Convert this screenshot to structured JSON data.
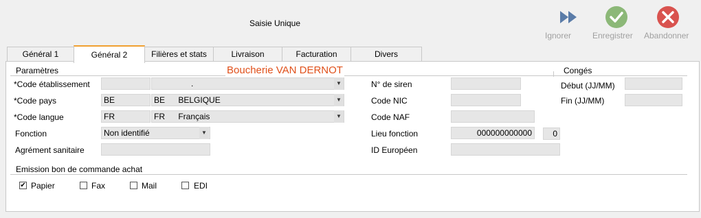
{
  "window": {
    "title": "Saisie Unique"
  },
  "toolbar": {
    "ignore_label": "Ignorer",
    "save_label": "Enregistrer",
    "abandon_label": "Abandonner"
  },
  "tabs": [
    {
      "label": "Général 1"
    },
    {
      "label": "Général 2",
      "active": true
    },
    {
      "label": "Filières et stats"
    },
    {
      "label": "Livraison"
    },
    {
      "label": "Facturation"
    },
    {
      "label": "Divers"
    }
  ],
  "form": {
    "section_params": "Paramètres",
    "company_name": "Boucherie VAN DERNOT",
    "section_conges": "Congés",
    "code_etab_label": "*Code établissement",
    "code_etab_value": "",
    "code_etab_desc": ".",
    "code_pays_label": "*Code pays",
    "code_pays_value": "BE",
    "code_pays_code": "BE",
    "code_pays_name": "BELGIQUE",
    "code_langue_label": "*Code langue",
    "code_langue_value": "FR",
    "code_langue_code": "FR",
    "code_langue_name": "Français",
    "fonction_label": "Fonction",
    "fonction_value": "Non identifié",
    "agrement_label": "Agrément sanitaire",
    "agrement_value": "",
    "siren_label": "N° de siren",
    "siren_value": "",
    "nic_label": "Code NIC",
    "nic_value": "",
    "naf_label": "Code NAF",
    "naf_value": "",
    "lieu_label": "Lieu fonction",
    "lieu_value": "000000000000",
    "lieu_suffix": "0",
    "id_europeen_label": "ID Européen",
    "id_europeen_value": "",
    "debut_label": "Début (JJ/MM)",
    "debut_value": "",
    "fin_label": "Fin (JJ/MM)",
    "fin_value": "",
    "emission_label": "Emission bon de commande achat",
    "opt_papier": "Papier",
    "opt_fax": "Fax",
    "opt_mail": "Mail",
    "opt_edi": "EDI",
    "papier_checked": true,
    "fax_checked": false,
    "mail_checked": false,
    "edi_checked": false
  },
  "colors": {
    "company_name": "#e0501a",
    "active_tab_accent": "#f0a030",
    "save_green": "#8cb878",
    "abandon_red": "#d9534f",
    "ignore_blue": "#5a7ca8"
  }
}
